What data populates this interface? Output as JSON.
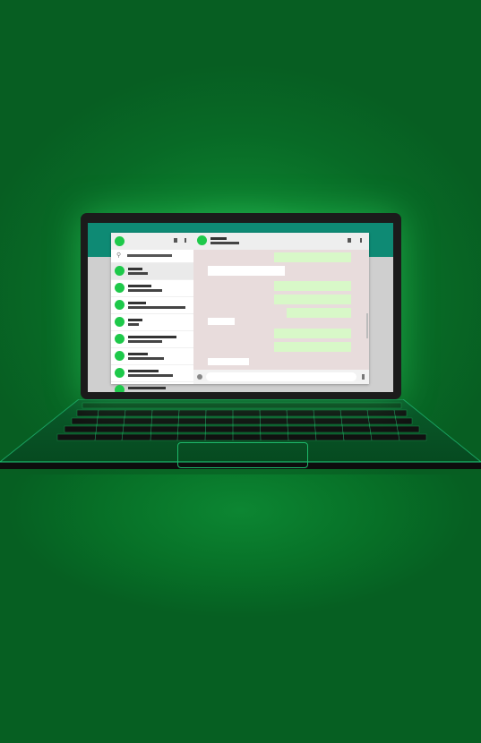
{
  "scene": {
    "description_free": true,
    "accent": "#1ec94a",
    "background": "#086a26",
    "screen_header": "#0e8a74",
    "outgoing_bubble": "#d8f8c8",
    "incoming_bubble": "#ffffff",
    "chat_background": "#e8dcdc"
  },
  "icons": [
    "avatar-icon",
    "search-icon",
    "menu-icon",
    "attach-icon",
    "mic-icon"
  ]
}
